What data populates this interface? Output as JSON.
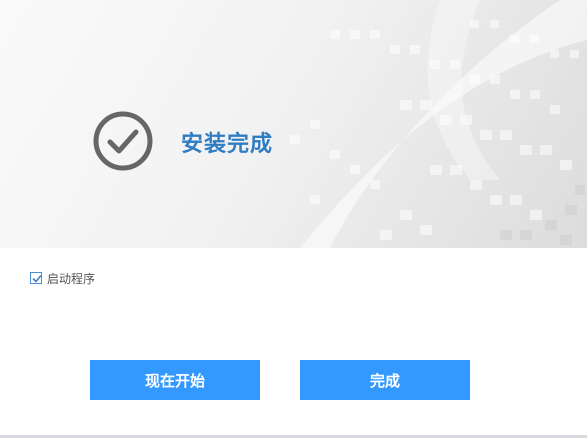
{
  "install": {
    "title": "安装完成",
    "launch_checkbox": {
      "label": "启动程序",
      "checked": true
    },
    "buttons": {
      "start_now": "现在开始",
      "finish": "完成"
    }
  },
  "colors": {
    "accent": "#3399ff",
    "title": "#2f7cc3",
    "check_icon": "#666666"
  }
}
